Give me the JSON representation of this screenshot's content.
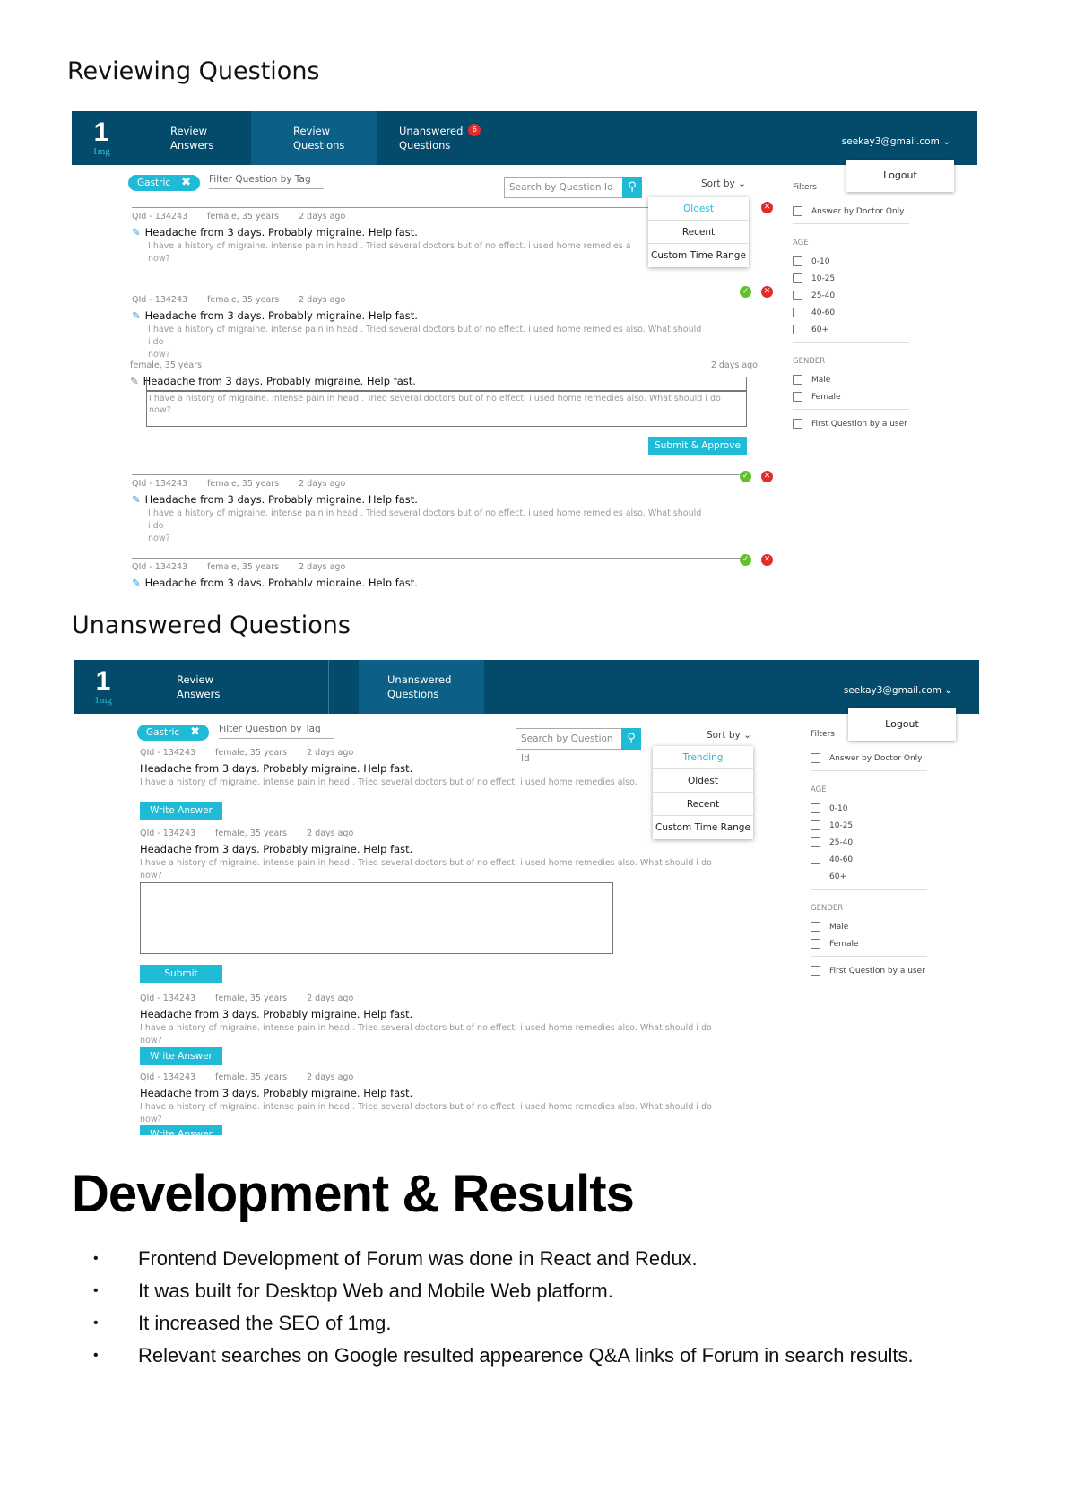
{
  "section1_heading": "Reviewing Questions",
  "section2_heading": "Unanswered Questions",
  "brand": {
    "one": "1",
    "img": "1mg"
  },
  "nav": {
    "review_answers": [
      "Review",
      "Answers"
    ],
    "review_questions": [
      "Review",
      "Questions"
    ],
    "unanswered_questions": [
      "Unanswered",
      "Questions"
    ],
    "badge": "6",
    "user_email": "seekay3@gmail.com",
    "logout": "Logout"
  },
  "toolbar": {
    "tag_chip": "Gastric",
    "filter_placeholder": "Filter Question by Tag",
    "search_placeholder": "Search by Question Id",
    "sort_by": "Sort by"
  },
  "sort_options_review": [
    "Oldest",
    "Recent",
    "Custom Time Range"
  ],
  "sort_options_unanswered": [
    "Trending",
    "Oldest",
    "Recent",
    "Custom Time Range"
  ],
  "filters": {
    "title": "Filters",
    "doctor_only": "Answer by Doctor Only",
    "age_label": "AGE",
    "age_options": [
      "0-10",
      "10-25",
      "25-40",
      "40-60",
      "60+"
    ],
    "gender_label": "GENDER",
    "gender_options": [
      "Male",
      "Female"
    ],
    "first_question": "First Question by a user"
  },
  "question": {
    "qid": "QId - 134243",
    "patient": "female, 35 years",
    "time": "2 days ago",
    "title": "Headache from 3 days. Probably migraine. Help fast.",
    "body": "I have a history of migraine. intense pain in head . Tried several doctors but of no effect. i used home remedies also. What should i do now?",
    "body_cut": "I have a history of migraine. intense pain in head . Tried several doctors but of no effect. i used home remedies a",
    "body_cut2": "I have a history of migraine. intense pain in head . Tried several doctors but of no effect. i used home remedies also.",
    "body_line1": "I have a history of migraine. intense pain in head . Tried several doctors but of no effect. i used home remedies also. What should i do",
    "body_line2": "now?",
    "now": "now?"
  },
  "buttons": {
    "submit_approve": "Submit & Approve",
    "write_answer": "Write Answer",
    "submit": "Submit"
  },
  "dev_title": "Development & Results",
  "bullets": [
    "Frontend Development of Forum was done in React and Redux.",
    "It was built for Desktop Web and Mobile Web platform.",
    "It increased the SEO of 1mg.",
    "Relevant searches on Google resulted appearence Q&A links of Forum in search results."
  ]
}
